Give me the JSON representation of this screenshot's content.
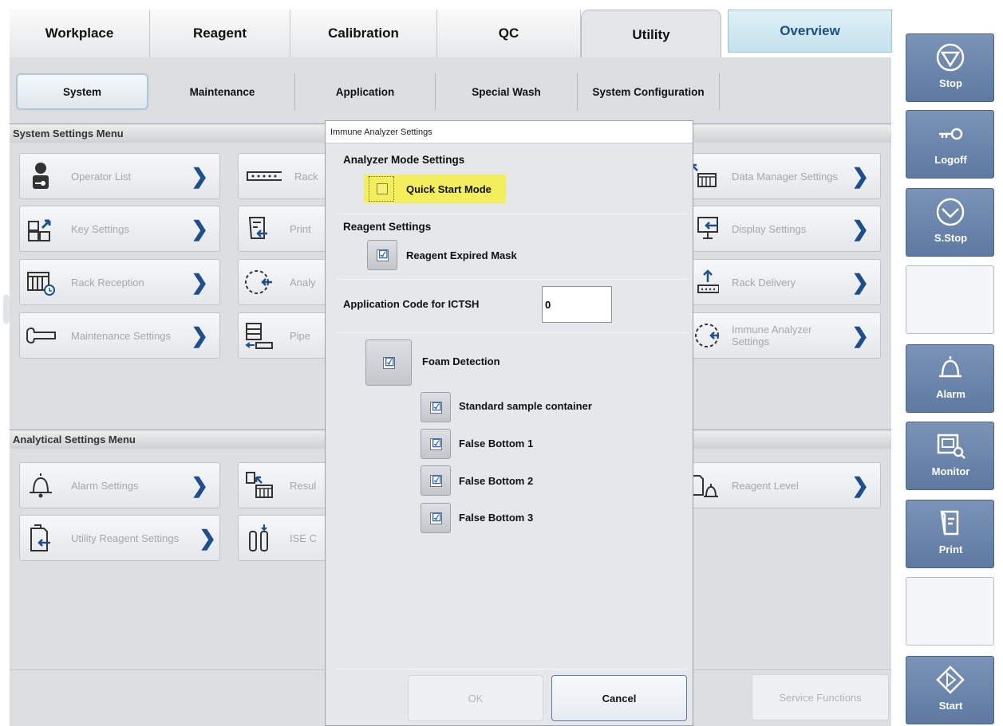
{
  "top_tabs": {
    "workplace": "Workplace",
    "reagent": "Reagent",
    "calibration": "Calibration",
    "qc": "QC",
    "utility": "Utility",
    "overview": "Overview"
  },
  "sub_tabs": {
    "system": "System",
    "maintenance": "Maintenance",
    "application": "Application",
    "special_wash": "Special Wash",
    "system_configuration": "System Configuration"
  },
  "system_menu": {
    "header": "System Settings Menu",
    "operator_list": "Operator List",
    "key_settings": "Key Settings",
    "rack_reception": "Rack Reception",
    "maintenance_settings": "Maintenance Settings",
    "rack": "Rack",
    "print": "Print",
    "analy": "Analy",
    "pipe": "Pipe",
    "data_manager_settings": "Data Manager Settings",
    "display_settings": "Display Settings",
    "rack_delivery": "Rack Delivery",
    "immune_analyzer_settings_1": "Immune Analyzer",
    "immune_analyzer_settings_2": "Settings"
  },
  "analytical_menu": {
    "header": "Analytical Settings Menu",
    "alarm_settings": "Alarm Settings",
    "utility_reagent_settings": "Utility Reagent Settings",
    "result": "Resul",
    "ise": "ISE C",
    "reagent_level": "Reagent Level"
  },
  "bottom": {
    "ok": "OK",
    "cancel": "Cancel",
    "service_functions": "Service Functions"
  },
  "dialog": {
    "title": "Immune Analyzer Settings",
    "analyzer_mode_heading": "Analyzer Mode Settings",
    "quick_start_mode": "Quick Start Mode",
    "reagent_heading": "Reagent Settings",
    "reagent_expired_mask": "Reagent Expired Mask",
    "app_code_label": "Application Code for ICTSH",
    "app_code_value": "0",
    "foam_detection": "Foam Detection",
    "standard_sample_container": "Standard sample container",
    "false_bottom_1": "False Bottom 1",
    "false_bottom_2": "False Bottom 2",
    "false_bottom_3": "False Bottom 3",
    "check_glyph": "☑"
  },
  "sidebar": {
    "stop": "Stop",
    "logoff": "Logoff",
    "s_stop": "S.Stop",
    "alarm": "Alarm",
    "monitor": "Monitor",
    "print": "Print",
    "start": "Start"
  },
  "chevron": "❯",
  "colors": {
    "accent_blue": "#1d4f8f",
    "sidebar_blue": "#6b86ad",
    "highlight_yellow": "#f2ee5c",
    "check_blue": "#2b67b8"
  }
}
